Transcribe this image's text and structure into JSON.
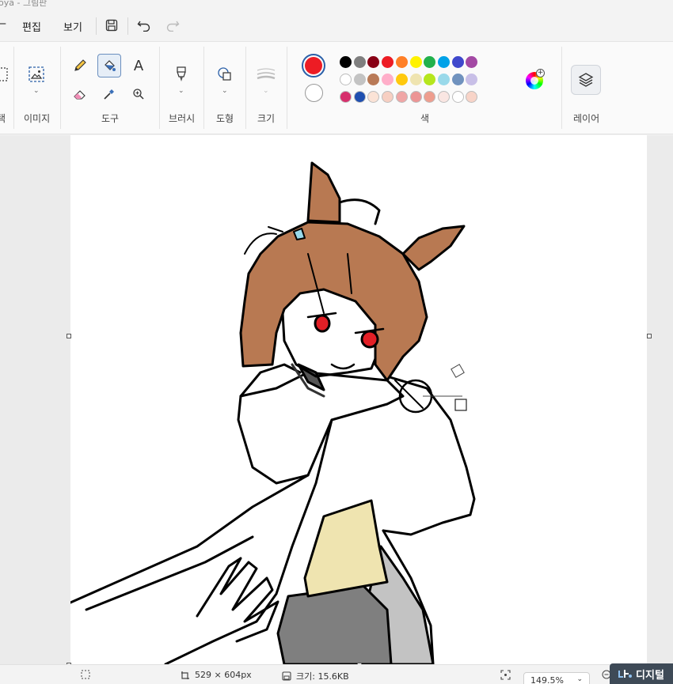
{
  "window": {
    "title": "oya - 그림판"
  },
  "menu": {
    "edit": "편집",
    "view": "보기"
  },
  "ribbon": {
    "groups": {
      "selection_fragment": "택",
      "image": "이미지",
      "tools": "도구",
      "brush": "브러시",
      "shapes": "도형",
      "size": "크기",
      "colors": "색",
      "layers": "레이어"
    },
    "tools_text_glyph": "A"
  },
  "colors": {
    "primary": "#ed1c24",
    "secondary": "#ffffff",
    "palette_row1": [
      "#000000",
      "#7f7f7f",
      "#880015",
      "#ed1c24",
      "#ff7f27",
      "#fff200",
      "#22b14c",
      "#00a2e8",
      "#3f48cc",
      "#a349a4"
    ],
    "palette_row2": [
      "#ffffff",
      "#c3c3c3",
      "#b97a57",
      "#ffaec9",
      "#ffc90e",
      "#efe4b0",
      "#b5e61d",
      "#99d9ea",
      "#7092be",
      "#c8bfe7"
    ],
    "palette_row3": [
      "#d62f6c",
      "#1f4fb0",
      "#fbe3d6",
      "#f7cfc2",
      "#f0a6a6",
      "#ec9595",
      "#ee9d8e",
      "#fae6e2",
      "#ffffff",
      "#f8d4c8"
    ]
  },
  "canvas": {
    "hair_color": "#b87952",
    "eye_color": "#e21f26",
    "vest_color": "#efe4b0",
    "skirt_color": "#7f7f7f",
    "coat_shadow_color": "#c3c3c3"
  },
  "status": {
    "dimensions": "529 × 604px",
    "size": "크기: 15.6KB",
    "zoom": "149.5%"
  },
  "watermark": {
    "text": "디지털"
  }
}
